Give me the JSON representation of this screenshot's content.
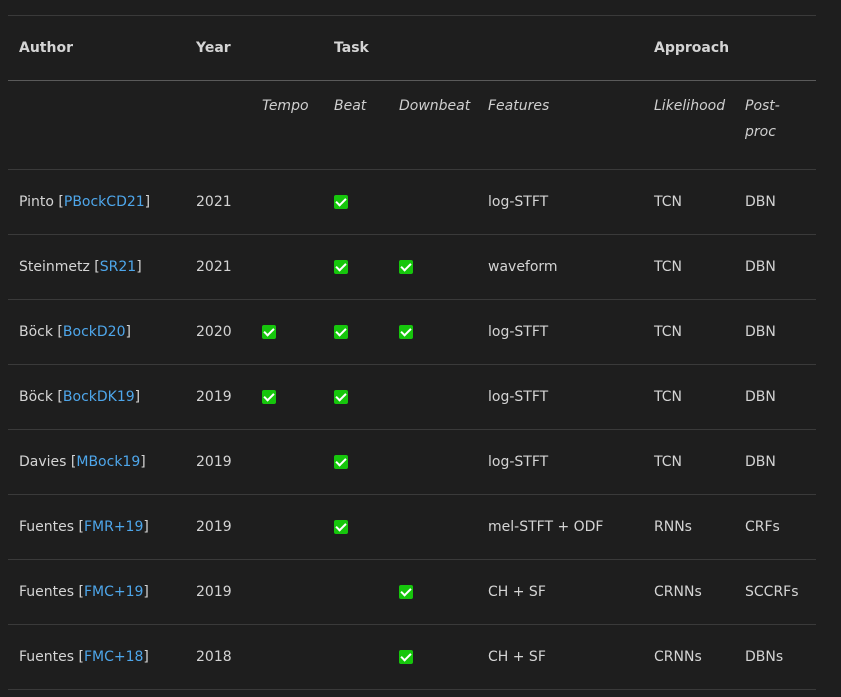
{
  "headers": {
    "author": "Author",
    "year": "Year",
    "task": "Task",
    "approach": "Approach"
  },
  "subheaders": {
    "tempo": "Tempo",
    "beat": "Beat",
    "downbeat": "Downbeat",
    "features": "Features",
    "likelihood": "Likelihood",
    "postproc_line1": "Post-",
    "postproc_line2": "proc"
  },
  "rows": [
    {
      "author": "Pinto",
      "cite": "PBockCD21",
      "year": "2021",
      "tempo": false,
      "beat": true,
      "downbeat": false,
      "features": "log-STFT",
      "likelihood": "TCN",
      "postproc": "DBN"
    },
    {
      "author": "Steinmetz",
      "cite": "SR21",
      "year": "2021",
      "tempo": false,
      "beat": true,
      "downbeat": true,
      "features": "waveform",
      "likelihood": "TCN",
      "postproc": "DBN"
    },
    {
      "author": "Böck",
      "cite": "BockD20",
      "year": "2020",
      "tempo": true,
      "beat": true,
      "downbeat": true,
      "features": "log-STFT",
      "likelihood": "TCN",
      "postproc": "DBN"
    },
    {
      "author": "Böck",
      "cite": "BockDK19",
      "year": "2019",
      "tempo": true,
      "beat": true,
      "downbeat": false,
      "features": "log-STFT",
      "likelihood": "TCN",
      "postproc": "DBN"
    },
    {
      "author": "Davies",
      "cite": "MBock19",
      "year": "2019",
      "tempo": false,
      "beat": true,
      "downbeat": false,
      "features": "log-STFT",
      "likelihood": "TCN",
      "postproc": "DBN"
    },
    {
      "author": "Fuentes",
      "cite": "FMR+19",
      "year": "2019",
      "tempo": false,
      "beat": true,
      "downbeat": false,
      "features": "mel-STFT + ODF",
      "likelihood": "RNNs",
      "postproc": "CRFs"
    },
    {
      "author": "Fuentes",
      "cite": "FMC+19",
      "year": "2019",
      "tempo": false,
      "beat": false,
      "downbeat": true,
      "features": "CH + SF",
      "likelihood": "CRNNs",
      "postproc": "SCCRFs"
    },
    {
      "author": "Fuentes",
      "cite": "FMC+18",
      "year": "2018",
      "tempo": false,
      "beat": false,
      "downbeat": true,
      "features": "CH + SF",
      "likelihood": "CRNNs",
      "postproc": "DBNs"
    }
  ],
  "colors": {
    "background": "#1e1e1e",
    "link": "#4ea6ea",
    "check": "#16c60c"
  },
  "icons": {
    "checkmark": "check-mark-button-icon"
  }
}
